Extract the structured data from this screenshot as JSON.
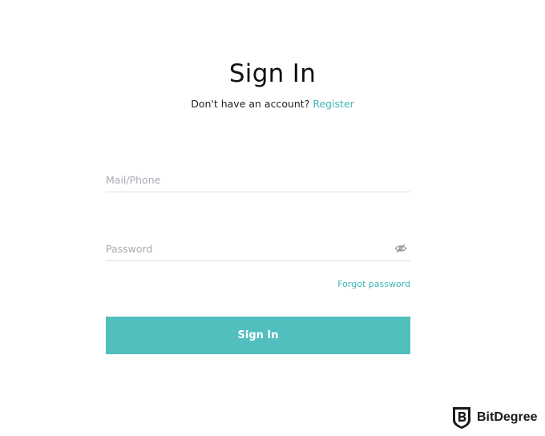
{
  "header": {
    "title": "Sign In",
    "prompt_text": "Don't have an account?",
    "register_label": "Register"
  },
  "form": {
    "mail": {
      "placeholder": "Mail/Phone",
      "value": ""
    },
    "password": {
      "placeholder": "Password",
      "value": "",
      "toggle_icon": "eye-slash-icon"
    },
    "forgot_label": "Forgot password",
    "submit_label": "Sign In"
  },
  "watermark": {
    "text": "BitDegree",
    "icon": "shield-logo-icon"
  },
  "colors": {
    "accent": "#3fb5b5",
    "button": "#52bfbf",
    "placeholder": "#a7abb2",
    "divider": "#dcdde0"
  }
}
